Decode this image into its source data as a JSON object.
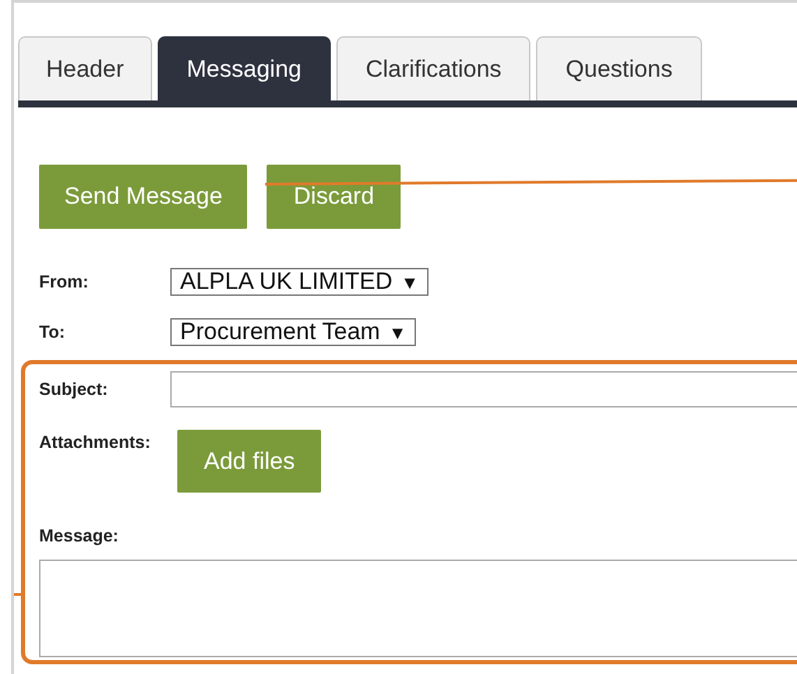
{
  "tabs": [
    {
      "label": "Header",
      "selected": false
    },
    {
      "label": "Messaging",
      "selected": true
    },
    {
      "label": "Clarifications",
      "selected": false
    },
    {
      "label": "Questions",
      "selected": false
    }
  ],
  "actions": [
    "Send Message",
    "Discard"
  ],
  "from": {
    "label": "From:",
    "value": "ALPLA UK LIMITED",
    "arrow": "▼"
  },
  "to": {
    "label": "To:",
    "value": "Procurement Team",
    "arrow": "▼"
  },
  "subject": {
    "label": "Subject:"
  },
  "attachments": {
    "label": "Attachments:",
    "button": "Add files"
  },
  "message": {
    "label": "Message:"
  }
}
